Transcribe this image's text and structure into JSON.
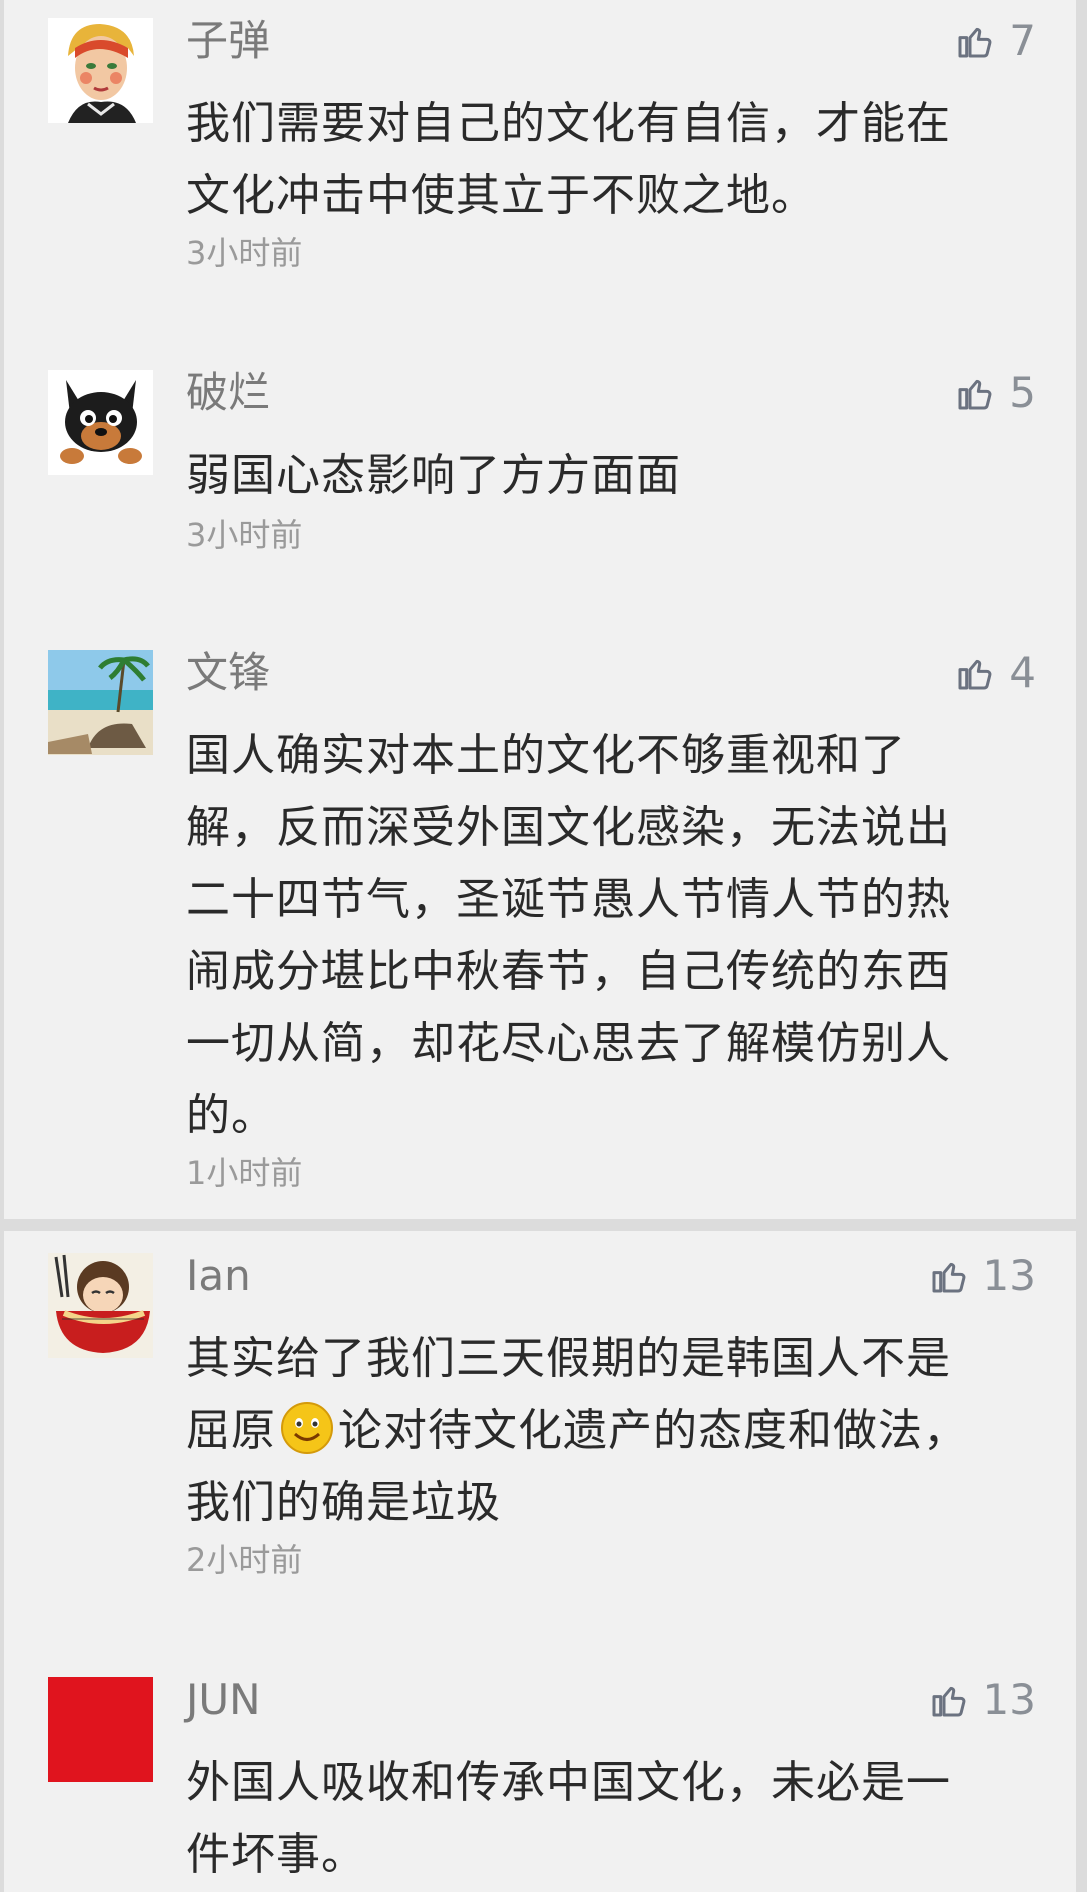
{
  "comments": [
    {
      "author": "子弹",
      "likes": "7",
      "text": "我们需要对自己的文化有自信，才能在\n文化冲击中使其立于不败之地。",
      "time": "3小时前",
      "avatar_icon": "cartoon-woman-portrait"
    },
    {
      "author": "破烂",
      "likes": "5",
      "text": "弱国心态影响了方方面面",
      "time": "3小时前",
      "avatar_icon": "cartoon-dog"
    },
    {
      "author": "文锋",
      "likes": "4",
      "text": "国人确实对本土的文化不够重视和了\n解，反而深受外国文化感染，无法说出\n二十四节气，圣诞节愚人节情人节的热\n闹成分堪比中秋春节，自己传统的东西\n一切从简，却花尽心思去了解模仿别人\n的。",
      "time": "1小时前",
      "avatar_icon": "beach-photo"
    },
    {
      "author": "Ian",
      "likes": "13",
      "text_before_emoji": "其实给了我们三天假期的是韩国人不是\n屈原",
      "text_after_emoji": "论对待文化遗产的态度和做法，\n我们的确是垃圾",
      "emoji": "smiley-emoji",
      "time": "2小时前",
      "avatar_icon": "noodle-bowl-girl"
    },
    {
      "author": "JUN",
      "likes": "13",
      "text": "外国人吸收和传承中国文化，未必是一\n件坏事。",
      "avatar_icon": "red-square"
    }
  ],
  "like_icon": "thumbs-up-icon"
}
